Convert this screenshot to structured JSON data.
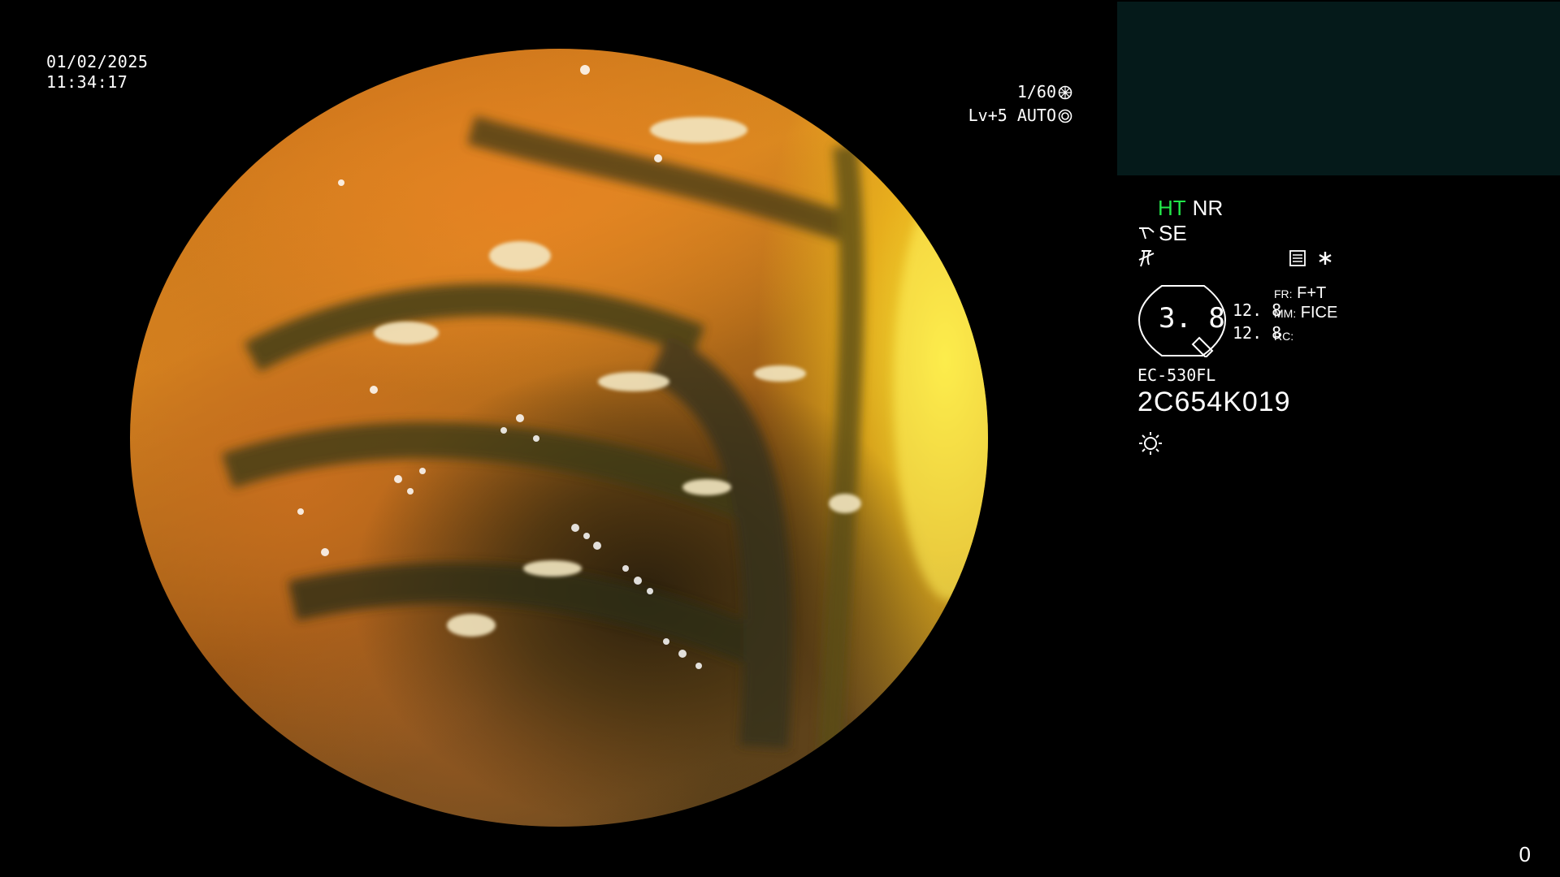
{
  "overlay": {
    "date": "01/02/2025",
    "time": "11:34:17",
    "shutter": "1/60",
    "level": "Lv+5 AUTO"
  },
  "status": {
    "ht": "HT",
    "nr": "NR",
    "se": "SE",
    "gauge_value": "3. 8",
    "readout_1": "12. 8",
    "readout_2": "12. 8",
    "fr_label": "FR:",
    "fr_value": "F+T",
    "mm_label": "MM:",
    "mm_value": "FICE",
    "rc_label": "RC:",
    "model": "EC-530FL",
    "serial": "2C654K019"
  },
  "corner": {
    "number": "0"
  },
  "colors": {
    "highlight": "#22e84a",
    "panel": "#051a1a",
    "text": "#ffffff"
  },
  "icons": [
    "shutter-icon",
    "auto-iris-icon",
    "scope-mode-icon",
    "filter-icon",
    "menu-icon",
    "asterisk-icon",
    "light-icon"
  ]
}
